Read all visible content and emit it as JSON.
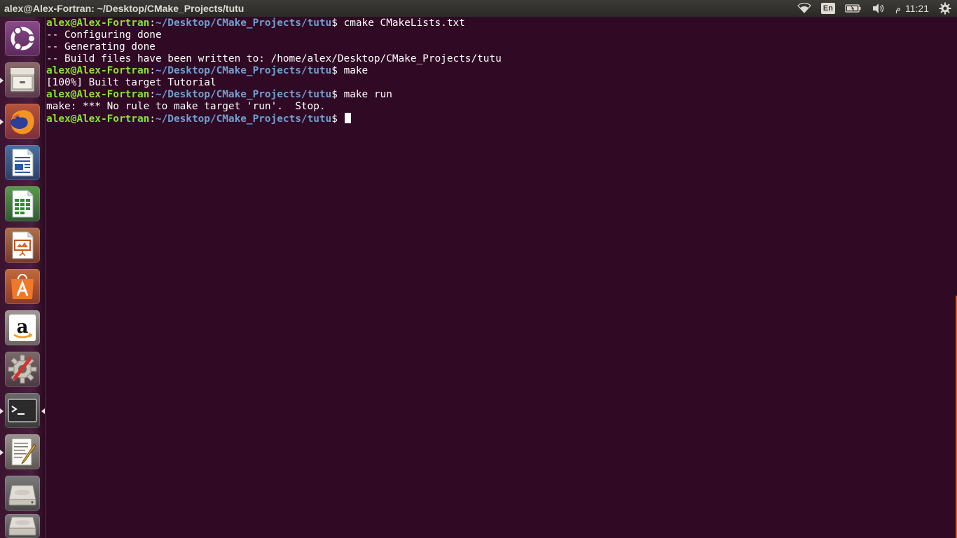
{
  "top_panel": {
    "window_title": "alex@Alex-Fortran: ~/Desktop/CMake_Projects/tutu",
    "keyboard_layout": "En",
    "clock_period": "م",
    "clock_time": "11:21",
    "icons": [
      "wifi-icon",
      "keyboard-icon",
      "battery-icon",
      "volume-icon",
      "gear-icon"
    ]
  },
  "launcher": {
    "items": [
      {
        "name": "dash-home",
        "icon": "ubuntu-logo-icon"
      },
      {
        "name": "files",
        "icon": "file-cabinet-icon"
      },
      {
        "name": "firefox",
        "icon": "firefox-icon"
      },
      {
        "name": "libreoffice-writer",
        "icon": "writer-icon"
      },
      {
        "name": "libreoffice-calc",
        "icon": "calc-icon"
      },
      {
        "name": "libreoffice-impress",
        "icon": "impress-icon"
      },
      {
        "name": "ubuntu-software",
        "icon": "software-bag-icon"
      },
      {
        "name": "amazon",
        "icon": "amazon-icon"
      },
      {
        "name": "system-settings",
        "icon": "settings-gear-icon"
      },
      {
        "name": "terminal",
        "icon": "terminal-icon"
      },
      {
        "name": "text-editor",
        "icon": "text-editor-icon"
      },
      {
        "name": "drive",
        "icon": "drive-icon"
      },
      {
        "name": "drive-2",
        "icon": "drive-icon"
      }
    ]
  },
  "terminal": {
    "lines": [
      {
        "user": "alex@Alex-Fortran",
        "path": "~/Desktop/CMake_Projects/tutu",
        "command": "cmake CMakeLists.txt"
      },
      {
        "text": "-- Configuring done"
      },
      {
        "text": "-- Generating done"
      },
      {
        "text": "-- Build files have been written to: /home/alex/Desktop/CMake_Projects/tutu"
      },
      {
        "user": "alex@Alex-Fortran",
        "path": "~/Desktop/CMake_Projects/tutu",
        "command": "make"
      },
      {
        "text": "[100%] Built target Tutorial"
      },
      {
        "user": "alex@Alex-Fortran",
        "path": "~/Desktop/CMake_Projects/tutu",
        "command": "make run"
      },
      {
        "text": "make: *** No rule to make target 'run'.  Stop."
      },
      {
        "user": "alex@Alex-Fortran",
        "path": "~/Desktop/CMake_Projects/tutu",
        "command": ""
      }
    ]
  },
  "colors": {
    "terminal_bg": "#300a24",
    "prompt_user": "#8ae234",
    "prompt_path": "#729fcf",
    "text": "#ffffff"
  }
}
